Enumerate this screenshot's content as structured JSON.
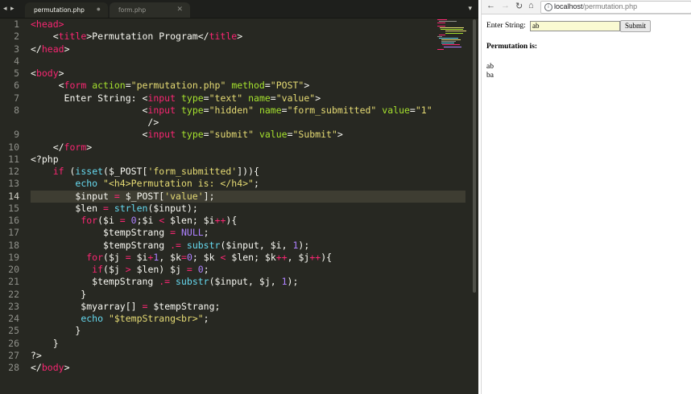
{
  "editor": {
    "nav_arrows": "◂ ▸",
    "tabs": [
      {
        "label": "permutation.php",
        "control": "●"
      },
      {
        "label": "form.php",
        "control": "✕"
      }
    ],
    "dropdown": "▾",
    "line_numbers": [
      "1",
      "2",
      "3",
      "4",
      "5",
      "6",
      "7",
      "8",
      "",
      "9",
      "10",
      "11",
      "12",
      "13",
      "14",
      "15",
      "16",
      "17",
      "18",
      "19",
      "20",
      "21",
      "22",
      "23",
      "24",
      "25",
      "26",
      "27",
      "28"
    ],
    "current_line": 14
  },
  "browser": {
    "back": "←",
    "forward": "→",
    "reload": "↻",
    "home": "⌂",
    "url_host": "localhost",
    "url_path": "/permutation.php",
    "page": {
      "input_label": "Enter String:",
      "input_value": "ab",
      "submit_label": "Submit",
      "heading": "Permutation is:",
      "results": [
        "ab",
        "ba"
      ]
    }
  },
  "colors": {
    "editor_bg": "#272822",
    "keyword": "#f92672",
    "string": "#e6db74",
    "attribute": "#a6e22e",
    "function": "#66d9ef",
    "number": "#ae81ff"
  }
}
